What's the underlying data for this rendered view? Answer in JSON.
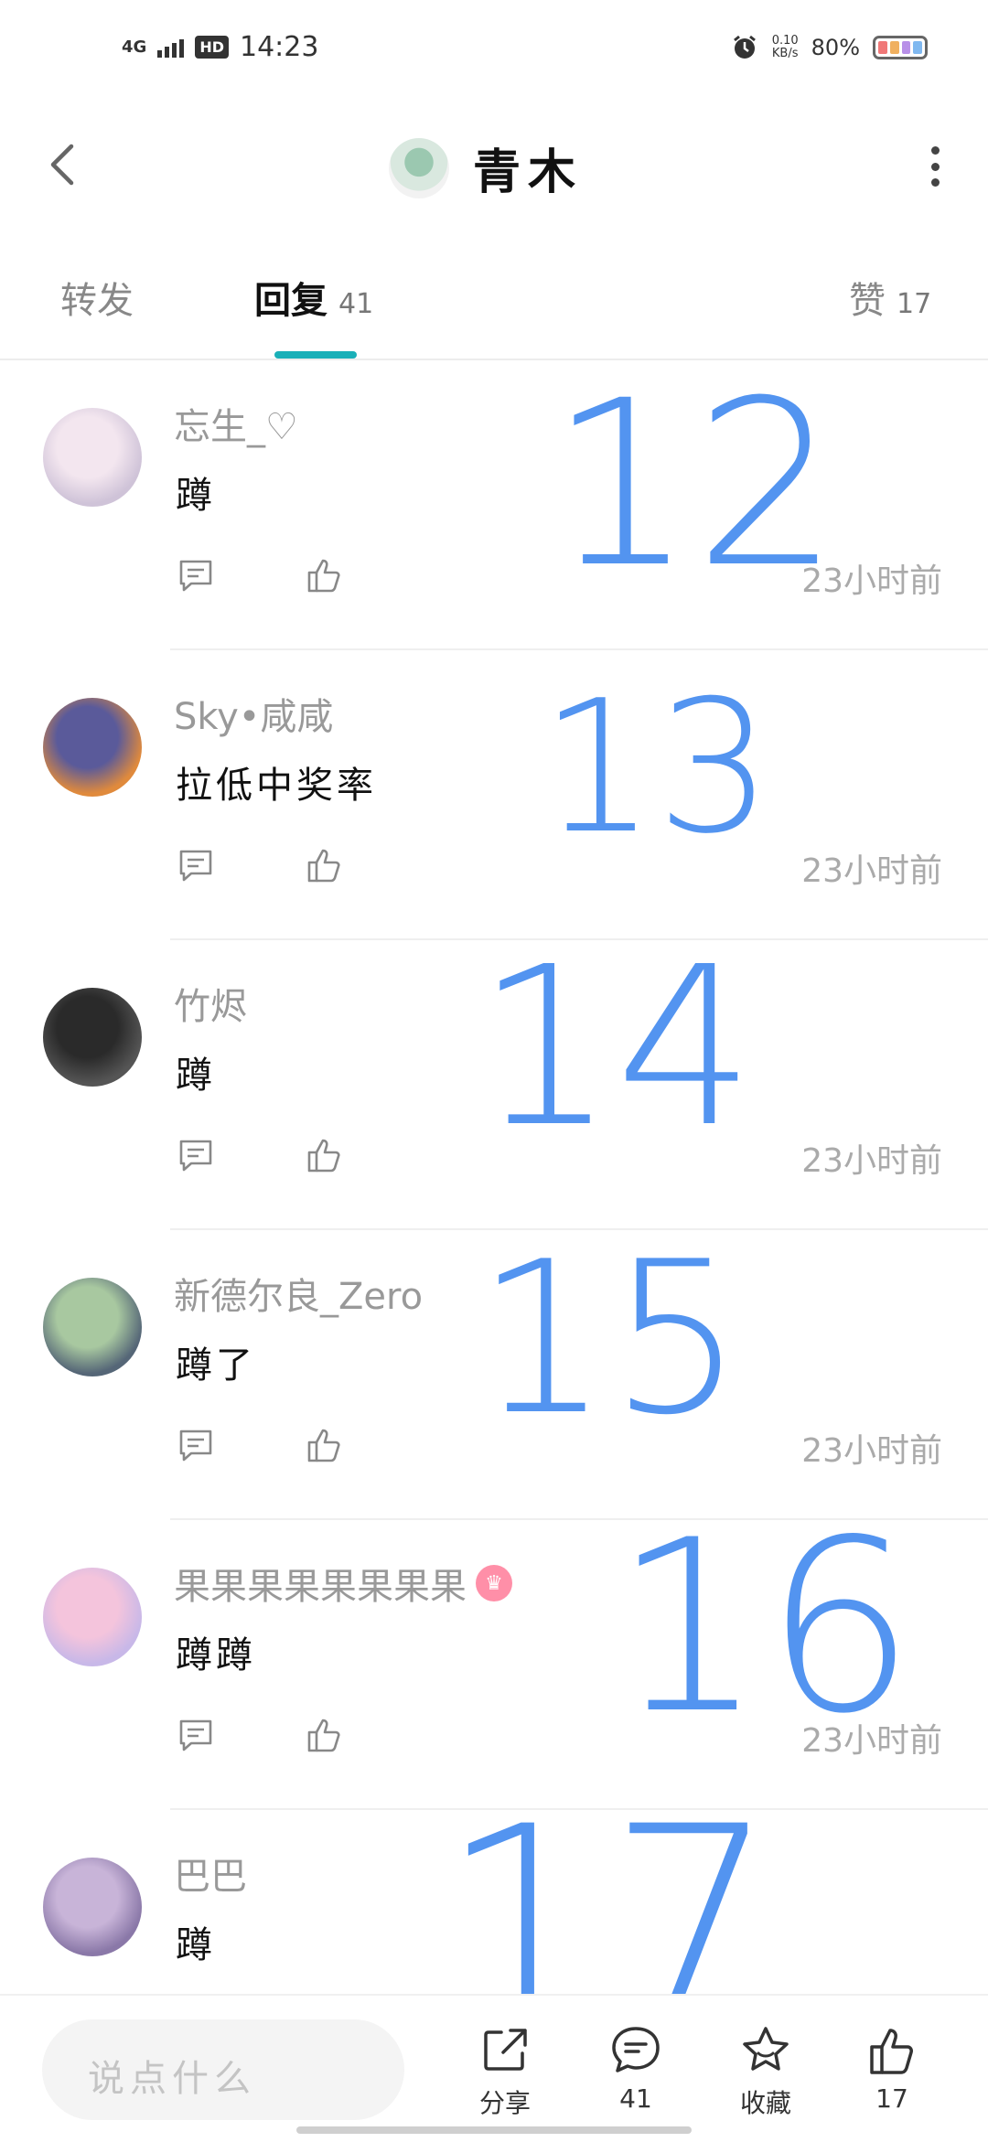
{
  "status_bar": {
    "network": "4G",
    "hd": "HD",
    "time": "14:23",
    "speed_value": "0.10",
    "speed_unit": "KB/s",
    "battery": "80%"
  },
  "header": {
    "title": "青木",
    "back_icon": "chevron-left-icon",
    "more_icon": "more-vertical-icon"
  },
  "tabs": [
    {
      "label": "转发",
      "count": ""
    },
    {
      "label": "回复",
      "count": "41"
    },
    {
      "label": "赞",
      "count": "17"
    }
  ],
  "comments": [
    {
      "user": "忘生_♡",
      "text": "蹲",
      "time": "23小时前",
      "crown": false,
      "avatar_colors": [
        "#f3e6ef",
        "#cfc3d8"
      ]
    },
    {
      "user": "Sky•咸咸",
      "text": "拉低中奖率",
      "time": "23小时前",
      "crown": false,
      "avatar_colors": [
        "#5a5a9a",
        "#e08a3c"
      ]
    },
    {
      "user": "竹烬",
      "text": "蹲",
      "time": "23小时前",
      "crown": false,
      "avatar_colors": [
        "#2a2a2a",
        "#555555"
      ]
    },
    {
      "user": "新德尔良_Zero",
      "text": "蹲了",
      "time": "23小时前",
      "crown": false,
      "avatar_colors": [
        "#a8c8a0",
        "#556677"
      ]
    },
    {
      "user": "果果果果果果果果",
      "text": "蹲蹲",
      "time": "23小时前",
      "crown": true,
      "avatar_colors": [
        "#f4c4dc",
        "#c8b8e8"
      ]
    },
    {
      "user": "巴巴",
      "text": "蹲",
      "time": "",
      "crown": false,
      "avatar_colors": [
        "#c8b4d8",
        "#8a78a8"
      ]
    }
  ],
  "handwritten_numbers": [
    "12",
    "13",
    "14",
    "15",
    "16",
    "17"
  ],
  "bottom_bar": {
    "input_placeholder": "说点什么",
    "share_label": "分享",
    "comment_count": "41",
    "favorite_label": "收藏",
    "like_count": "17"
  },
  "colors": {
    "accent": "#1ab0b8",
    "handwriting": "#4a8ff0",
    "crown": "#ff8fa8"
  }
}
